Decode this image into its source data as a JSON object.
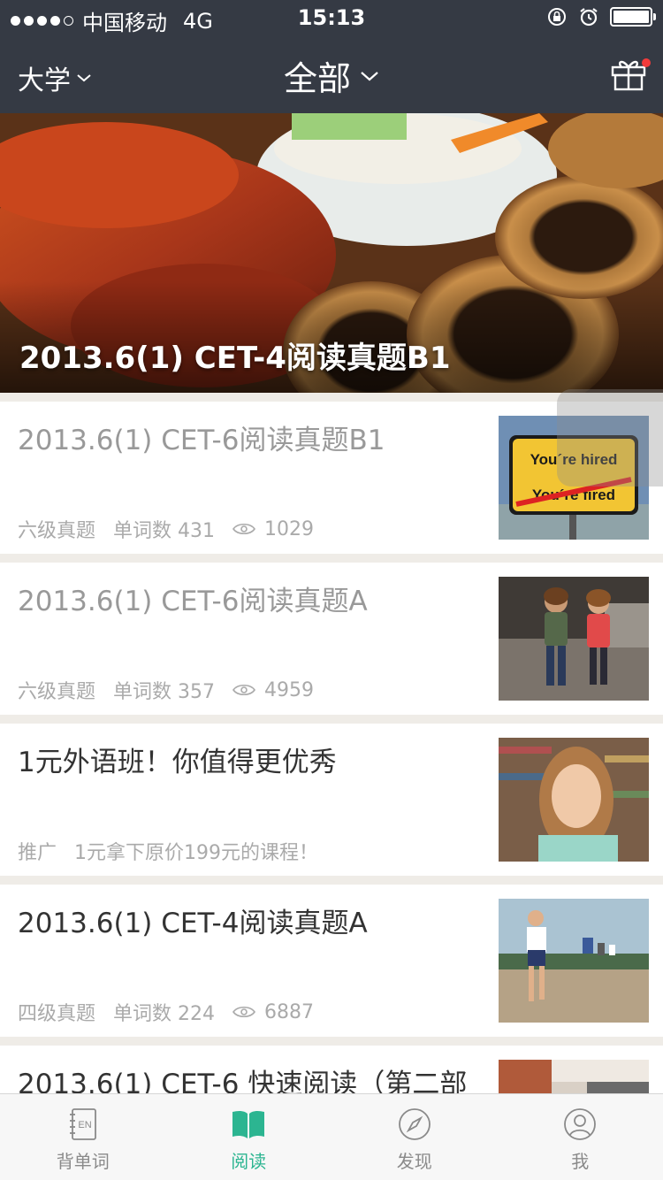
{
  "status": {
    "carrier": "中国移动",
    "network": "4G",
    "time": "15:13"
  },
  "nav": {
    "left_label": "大学",
    "center_label": "全部"
  },
  "hero": {
    "title": "2013.6(1) CET-4阅读真题B1"
  },
  "items": [
    {
      "title": "2013.6(1) CET-6阅读真题B1",
      "tag": "六级真题",
      "words": "单词数 431",
      "views": "1029",
      "read": true,
      "thumb_text_1": "You´re hired",
      "thumb_text_2": "You´re fired"
    },
    {
      "title": "2013.6(1) CET-6阅读真题A",
      "tag": "六级真题",
      "words": "单词数 357",
      "views": "4959",
      "read": true
    },
    {
      "title": "1元外语班！你值得更优秀",
      "tag": "推广",
      "words": "1元拿下原价199元的课程！",
      "views": "",
      "read": false
    },
    {
      "title": "2013.6(1) CET-4阅读真题A",
      "tag": "四级真题",
      "words": "单词数 224",
      "views": "6887",
      "read": false
    },
    {
      "title": "2013.6(1) CET-6 快速阅读（第二部",
      "tag": "",
      "words": "",
      "views": "",
      "read": false
    }
  ],
  "tabs": [
    {
      "label": "背单词",
      "icon": "vocabulary-book-icon",
      "icon_text": "EN"
    },
    {
      "label": "阅读",
      "icon": "open-book-icon"
    },
    {
      "label": "发现",
      "icon": "compass-icon"
    },
    {
      "label": "我",
      "icon": "profile-icon"
    }
  ],
  "colors": {
    "header_bg": "#353a44",
    "accent": "#2cb591",
    "notification_dot": "#f23b3b"
  }
}
